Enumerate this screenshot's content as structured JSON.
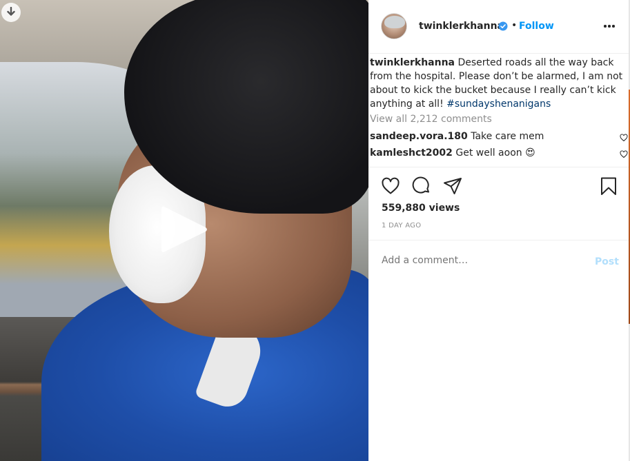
{
  "post": {
    "username": "twinklerkhanna",
    "separator": "•",
    "follow_label": "Follow",
    "caption_text": "Deserted roads all the way back from the hospital. Please don’t be alarmed, I am not about to kick the bucket because I really can’t kick anything at all! ",
    "caption_hashtag": "#sundayshenanigans",
    "view_all_comments": "View all 2,212 comments",
    "comments": [
      {
        "username": "sandeep.vora.180",
        "text": "Take care mem"
      },
      {
        "username": "kamleshct2002",
        "text": "Get well aoon 😍"
      }
    ],
    "views": "559,880 views",
    "time_ago": "1 DAY AGO",
    "add_comment_placeholder": "Add a comment…",
    "post_label": "Post"
  },
  "icons": {
    "download": "download-icon",
    "play": "play-icon",
    "verified": "verified-badge-icon",
    "more": "more-options-icon",
    "like": "heart-icon",
    "comment": "comment-icon",
    "share": "share-icon",
    "save": "bookmark-icon"
  },
  "colors": {
    "link_blue": "#0095f6",
    "post_disabled": "#b2dffc",
    "muted": "#8e8e8e",
    "text": "#262626",
    "hashtag": "#00376b"
  }
}
